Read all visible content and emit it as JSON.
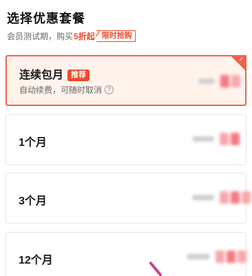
{
  "header": {
    "title": "选择优惠套餐",
    "subtitle_prefix": "会员测试期，购买",
    "subtitle_highlight": "5折起",
    "flash_tag": "限时抢购"
  },
  "plans": [
    {
      "name": "连续包月",
      "badge": "推荐",
      "description": "自动续费，可随时取消",
      "info_icon": "question-circle-icon",
      "selected": true,
      "price_blurred": true
    },
    {
      "name": "1个月",
      "selected": false,
      "price_blurred": true
    },
    {
      "name": "3个月",
      "selected": false,
      "price_blurred": true
    },
    {
      "name": "12个月",
      "selected": false,
      "price_blurred": true
    }
  ],
  "colors": {
    "accent": "#f04a2a",
    "selected_border": "#f0624a",
    "selected_background": "#fff3ec",
    "card_border": "#e5e5e5"
  },
  "info_glyph": "?"
}
